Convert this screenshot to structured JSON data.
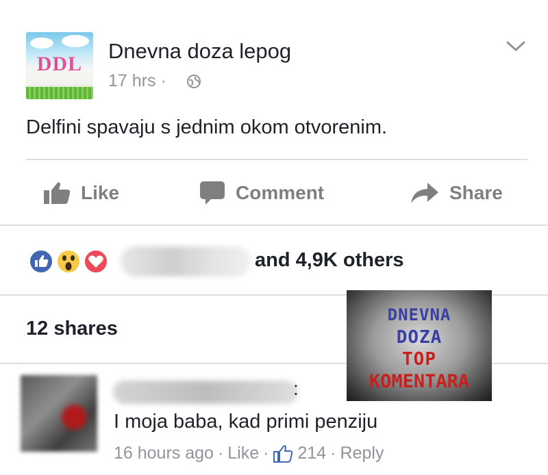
{
  "post": {
    "page_name": "Dnevna doza lepog",
    "avatar_text": "DDL",
    "time": "17 hrs",
    "time_separator": "·",
    "body": "Delfini spavaju s jednim okom otvorenim."
  },
  "actions": {
    "like": "Like",
    "comment": "Comment",
    "share": "Share"
  },
  "reactions": {
    "types": [
      "like",
      "wow",
      "love"
    ],
    "others_text": "and 4,9K others"
  },
  "shares_text": "12 shares",
  "overlay_badge": {
    "lines": [
      "DNEVNA",
      "DOZA",
      "TOP",
      "KOMENTARA"
    ],
    "colors": [
      "#3a3fa8",
      "#3a3fa8",
      "#c8201c",
      "#c8201c"
    ]
  },
  "comment": {
    "name_suffix": ":",
    "text": "I moja baba, kad primi penziju",
    "time": "16 hours ago",
    "like_label": "Like",
    "like_count": "214",
    "reply_label": "Reply",
    "sep": "·"
  },
  "colors": {
    "text": "#1d2129",
    "muted": "#90949c",
    "action": "#7f7f7f",
    "divider": "#dddfe2",
    "like_blue": "#4267b2",
    "love_red": "#ed4956",
    "wow_yellow": "#f7c948"
  }
}
